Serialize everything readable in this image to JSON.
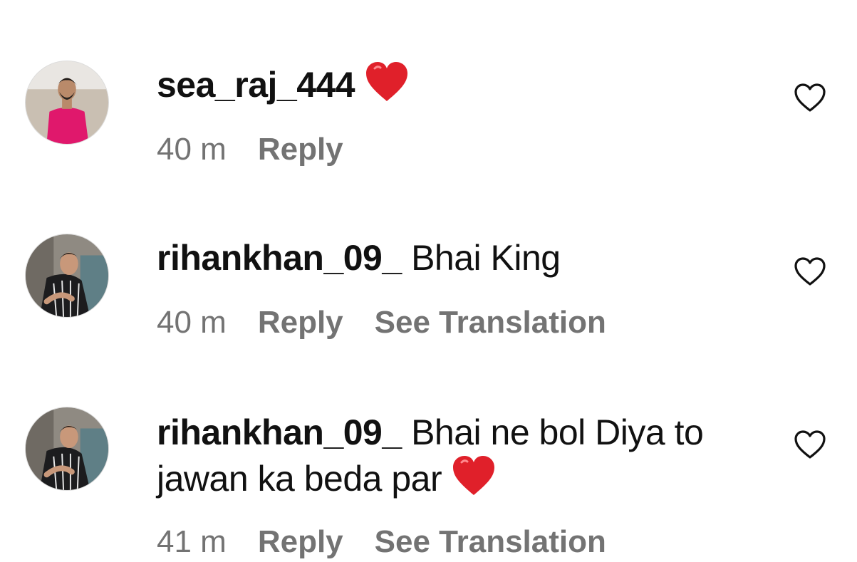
{
  "comments": [
    {
      "username": "sea_raj_444",
      "text": "",
      "emoji": "heart-emoji",
      "time": "40 m",
      "reply_label": "Reply",
      "translate_label": "",
      "like_icon": "heart-outline-icon"
    },
    {
      "username": "rihankhan_09_",
      "text": "Bhai King",
      "emoji": "",
      "time": "40 m",
      "reply_label": "Reply",
      "translate_label": "See Translation",
      "like_icon": "heart-outline-icon"
    },
    {
      "username": "rihankhan_09_",
      "text": "Bhai ne bol Diya to jawan ka beda par",
      "emoji": "heart-emoji",
      "time": "41 m",
      "reply_label": "Reply",
      "translate_label": "See Translation",
      "like_icon": "heart-outline-icon"
    }
  ],
  "colors": {
    "text": "#111111",
    "meta": "#737373",
    "heart_emoji": "#e0202a",
    "avatar1_shirt": "#e0186c"
  }
}
